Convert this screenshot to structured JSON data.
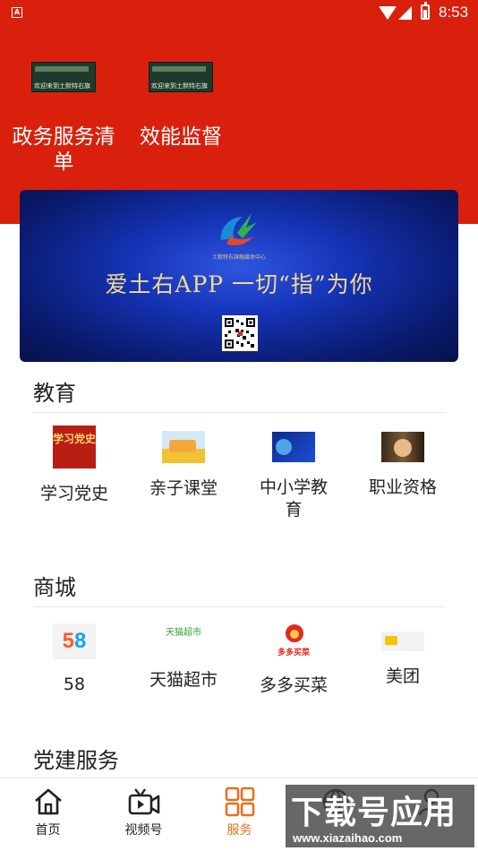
{
  "status_bar": {
    "app_badge": "A",
    "time": "8:53"
  },
  "gov_services": [
    {
      "label": "政务服务清单",
      "thumb_caption": "欢迎来到土默特右旗"
    },
    {
      "label": "效能监督",
      "thumb_caption": "欢迎来到土默特右旗"
    }
  ],
  "banner": {
    "logo_caption": "土默特右旗融媒体中心",
    "slogan": "爱土右APP 一切“指”为你"
  },
  "sections": {
    "education": {
      "title": "教育",
      "items": [
        {
          "label": "学习党史",
          "icon_text": "学习党史"
        },
        {
          "label": "亲子课堂"
        },
        {
          "label": "中小学教育"
        },
        {
          "label": "职业资格"
        }
      ]
    },
    "mall": {
      "title": "商城",
      "items": [
        {
          "label": "58",
          "icon_text": "58"
        },
        {
          "label": "天猫超市",
          "icon_text": "天猫超市"
        },
        {
          "label": "多多买菜",
          "icon_text": "多多买菜"
        },
        {
          "label": "美团"
        }
      ]
    },
    "party": {
      "title": "党建服务"
    }
  },
  "tabbar": {
    "items": [
      {
        "label": "首页"
      },
      {
        "label": "视频号"
      },
      {
        "label": "服务"
      },
      {
        "label": ""
      },
      {
        "label": ""
      }
    ],
    "active_index": 2
  },
  "watermark": {
    "line1": "下载号应用",
    "line2": "www.xiazaihao.com"
  },
  "colors": {
    "hero_red": "#d9200d",
    "active_tab": "#e5711f",
    "banner_blue": "#1534b7"
  }
}
